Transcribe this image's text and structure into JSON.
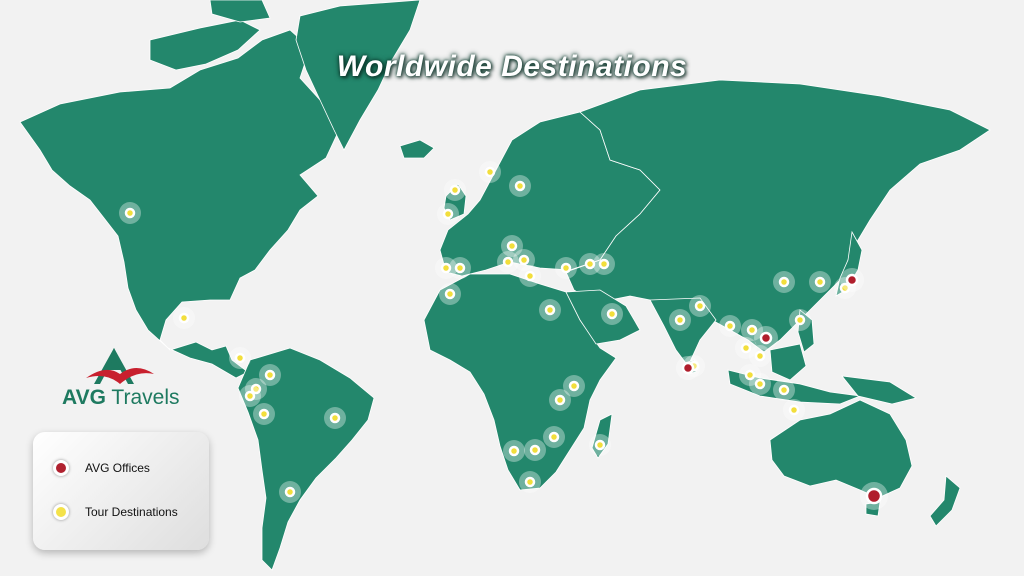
{
  "title": "Worldwide Destinations",
  "brand": {
    "name_part1": "AVG",
    "name_part2": "Travels",
    "color": "#1e7a60",
    "accent": "#c8202e"
  },
  "legend": {
    "items": [
      {
        "label": "AVG Offices",
        "color": "#b01e2c"
      },
      {
        "label": "Tour Destinations",
        "color": "#f2de3c"
      }
    ]
  },
  "colors": {
    "land": "#23876c",
    "ocean": "#f2f2f2"
  },
  "offices": [
    {
      "name": "Japan"
    },
    {
      "name": "Vietnam"
    },
    {
      "name": "Sri Lanka"
    },
    {
      "name": "Australia"
    }
  ]
}
